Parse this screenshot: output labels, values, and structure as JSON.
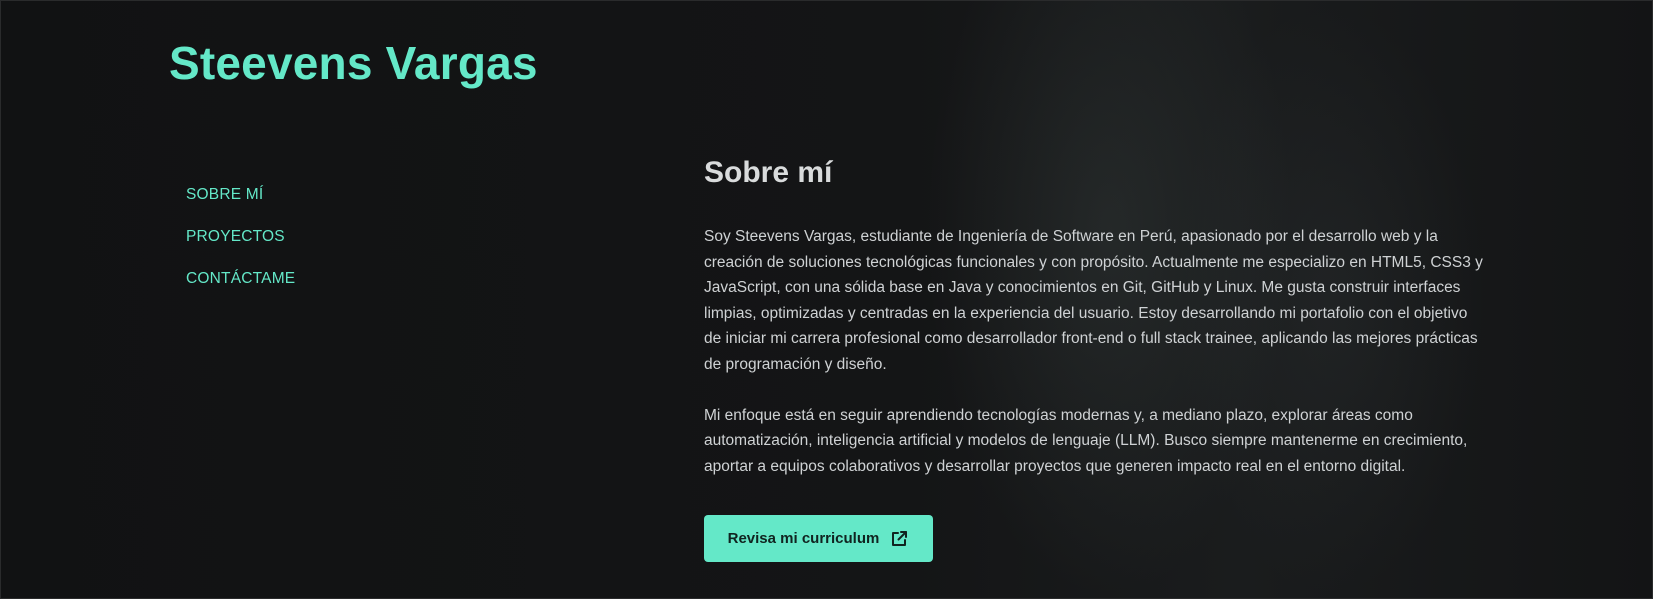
{
  "site": {
    "title": "Steevens Vargas"
  },
  "nav": {
    "items": [
      {
        "label": "SOBRE MÍ"
      },
      {
        "label": "PROYECTOS"
      },
      {
        "label": "CONTÁCTAME"
      }
    ]
  },
  "about": {
    "heading": "Sobre mí",
    "paragraphs": [
      "Soy Steevens Vargas, estudiante de Ingeniería de Software en Perú, apasionado por el desarrollo web y la creación de soluciones tecnológicas funcionales y con propósito. Actualmente me especializo en HTML5, CSS3 y JavaScript, con una sólida base en Java y conocimientos en Git, GitHub y Linux. Me gusta construir interfaces limpias, optimizadas y centradas en la experiencia del usuario. Estoy desarrollando mi portafolio con el objetivo de iniciar mi carrera profesional como desarrollador front-end o full stack trainee, aplicando las mejores prácticas de programación y diseño.",
      "Mi enfoque está en seguir aprendiendo tecnologías modernas y, a mediano plazo, explorar áreas como automatización, inteligencia artificial y modelos de lenguaje (LLM). Busco siempre mantenerme en crecimiento, aportar a equipos colaborativos y desarrollar proyectos que generen impacto real en el entorno digital."
    ],
    "cv_button": {
      "label": "Revisa mi curriculum",
      "icon": "external-link-icon"
    }
  },
  "colors": {
    "accent": "#64e8c8",
    "background": "#121314",
    "text": "#cfd2d4",
    "button_text": "#102420"
  }
}
